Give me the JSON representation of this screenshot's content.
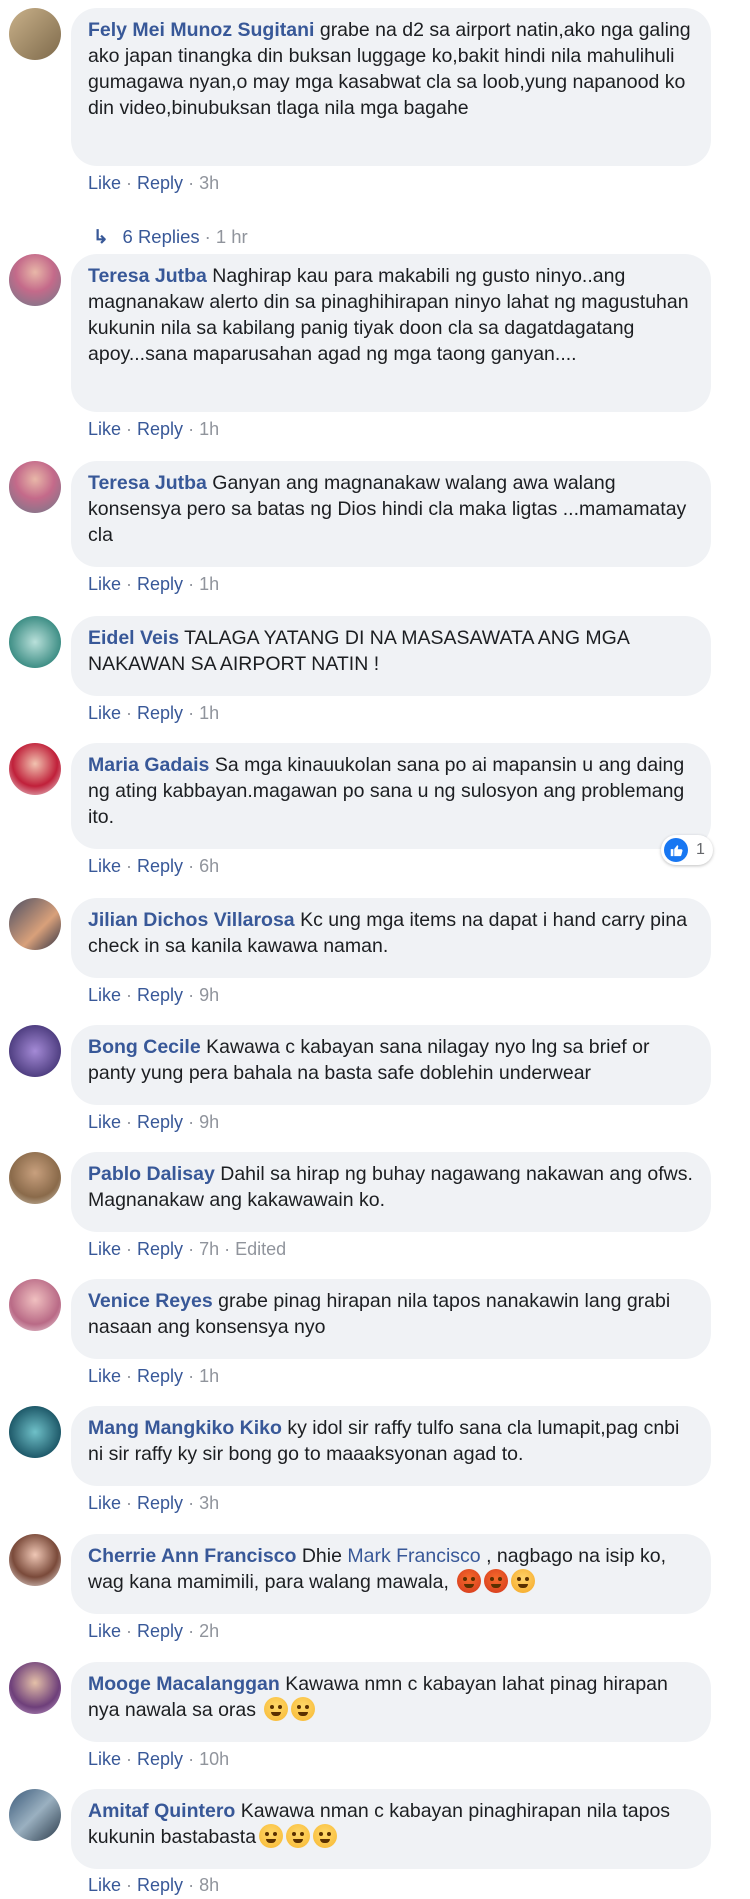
{
  "actions": {
    "like": "Like",
    "reply": "Reply",
    "dot": "·"
  },
  "replies": {
    "label": "6 Replies",
    "time": "1 hr"
  },
  "reaction": {
    "count": "1"
  },
  "colors": {
    "link": "#385898",
    "bubble": "#f0f2f5",
    "meta": "#90949c",
    "like_blue": "#1877f2"
  },
  "comments": [
    {
      "author": "Fely Mei Munoz Sugitani",
      "text": "grabe na d2 sa airport natin,ako nga galing ako japan tinangka din buksan luggage ko,bakit hindi nila mahulihuli gumagawa nyan,o may mga kasabwat cla sa loob,yung napanood ko din video,binubuksan tlaga nila mga bagahe",
      "time": "3h"
    },
    {
      "author": "Teresa Jutba",
      "text": "Naghirap kau para makabili ng gusto ninyo..ang magnanakaw alerto din sa pinaghihirapan ninyo lahat ng magustuhan kukunin nila sa kabilang panig tiyak doon cla sa dagatdagatang apoy...sana maparusahan agad ng mga taong ganyan....",
      "time": "1h"
    },
    {
      "author": "Teresa Jutba",
      "text": "Ganyan ang magnanakaw walang awa walang konsensya pero sa batas ng Dios hindi cla maka ligtas ...mamamatay cla",
      "time": "1h"
    },
    {
      "author": "Eidel Veis",
      "text": "TALAGA YATANG DI NA MASASAWATA ANG MGA NAKAWAN SA AIRPORT NATIN !",
      "time": "1h"
    },
    {
      "author": "Maria Gadais",
      "text": "Sa mga kinauukolan sana po ai mapansin u ang daing ng ating kabbayan.magawan po sana u ng sulosyon ang problemang ito.",
      "time": "6h"
    },
    {
      "author": "Jilian Dichos Villarosa",
      "text": "Kc ung mga items na dapat i hand carry pina check in sa kanila kawawa naman.",
      "time": "9h"
    },
    {
      "author": "Bong Cecile",
      "text": "Kawawa c kabayan sana nilagay nyo lng sa brief or panty yung pera bahala na basta safe doblehin underwear",
      "time": "9h"
    },
    {
      "author": "Pablo Dalisay",
      "text": "Dahil sa hirap ng buhay nagawang nakawan ang ofws. Magnanakaw ang kakawawain ko.",
      "time": "7h",
      "edited": "Edited"
    },
    {
      "author": "Venice Reyes",
      "text": "grabe pinag hirapan nila tapos nanakawin lang grabi nasaan ang konsensya nyo",
      "time": "1h"
    },
    {
      "author": "Mang Mangkiko Kiko",
      "text": "ky idol sir raffy tulfo sana cla lumapit,pag cnbi ni sir raffy ky sir bong go to maaaksyonan agad to.",
      "time": "3h"
    },
    {
      "author": "Cherrie Ann Francisco",
      "text_before": "Dhie",
      "mention": "Mark Francisco",
      "text_after": ", nagbago na isip ko, wag kana mamimili, para walang mawala,",
      "emoji": [
        "angry-face",
        "angry-face",
        "huffing-face"
      ],
      "time": "2h"
    },
    {
      "author": "Mooge Macalanggan",
      "text": "Kawawa nmn c kabayan lahat pinag hirapan nya nawala sa oras",
      "emoji": [
        "tears-of-joy-face",
        "tears-of-joy-face"
      ],
      "time": "10h"
    },
    {
      "author": "Amitaf Quintero",
      "text": "Kawawa nman c kabayan pinaghirapan nila tapos kukunin bastabasta",
      "emoji": [
        "weary-face",
        "weary-face",
        "weary-face"
      ],
      "time": "8h"
    }
  ]
}
